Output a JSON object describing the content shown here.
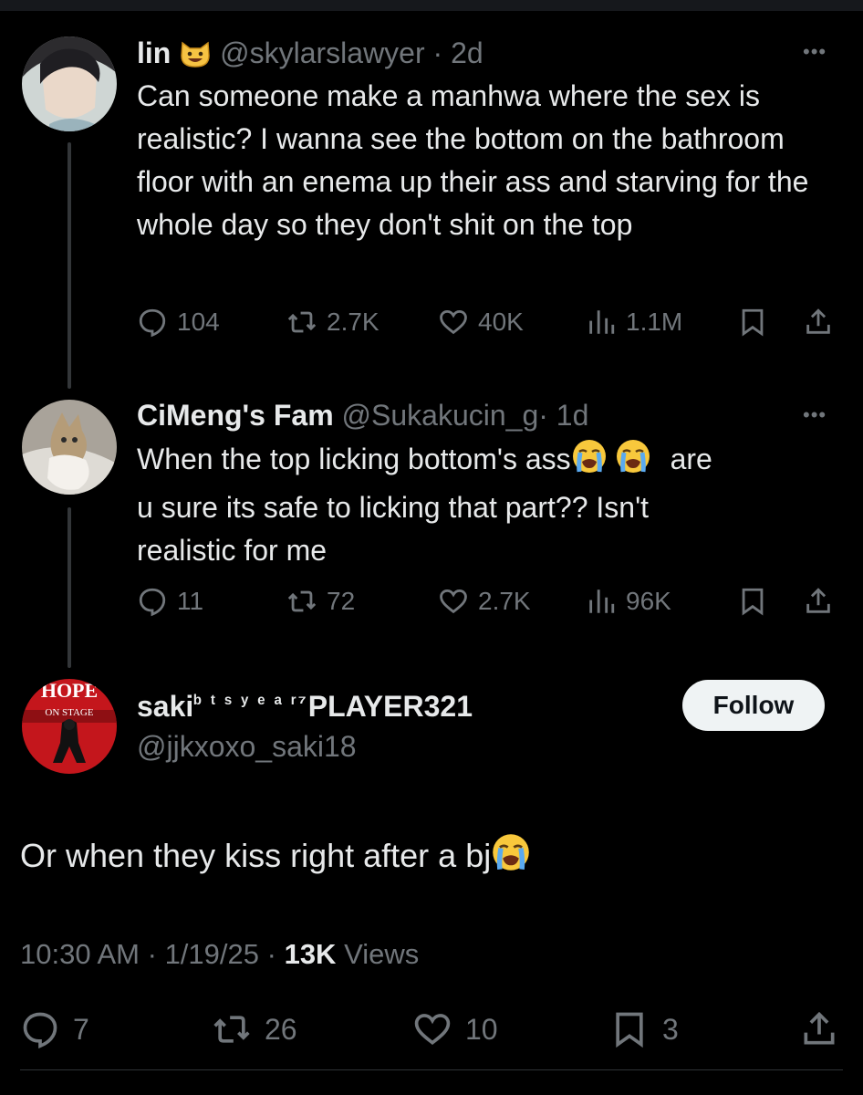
{
  "tweet1": {
    "name": "lin",
    "name_emoji": "smiling-cat-emoji",
    "handle": "@skylarslawyer",
    "time": "· 2d",
    "text": "Can someone make a manhwa where the sex is realistic? I wanna see the bottom on the bathroom floor with an enema up their ass and starving for the whole day so they don't shit on the top",
    "replies": "104",
    "reposts": "2.7K",
    "likes": "40K",
    "views": "1.1M"
  },
  "tweet2": {
    "name": "CiMeng's Fam",
    "handle": "@Sukakucin_g",
    "time": "· 1d",
    "text_before": "When the top licking bottom's ass",
    "text_after_line1": "are",
    "text_line2": "u sure its safe to licking that part?? Isn't",
    "text_line3": "realistic for me",
    "emoji": "loudly-crying-face-emoji",
    "replies": "11",
    "reposts": "72",
    "likes": "2.7K",
    "views": "96K"
  },
  "main": {
    "name_prefix": "saki",
    "name_super": "ᵇ ᵗ ˢ ʸ ᵉ ᵃ ʳ⁷",
    "name_suffix": "PLAYER321",
    "handle": "@jjkxoxo_saki18",
    "follow_label": "Follow",
    "avatar_text_top": "HOPE",
    "avatar_text_mid": "ON STAGE",
    "text": "Or when they kiss right after a bj",
    "emoji": "loudly-crying-face-emoji",
    "time": "10:30 AM",
    "date": "1/19/25",
    "views_count": "13K",
    "views_label": "Views",
    "replies": "7",
    "reposts": "26",
    "likes": "10",
    "bookmarks": "3",
    "meta_sep": "·"
  },
  "colors": {
    "text": "#e7e9ea",
    "muted": "#71767b",
    "bg": "#000000",
    "line": "#333639"
  }
}
